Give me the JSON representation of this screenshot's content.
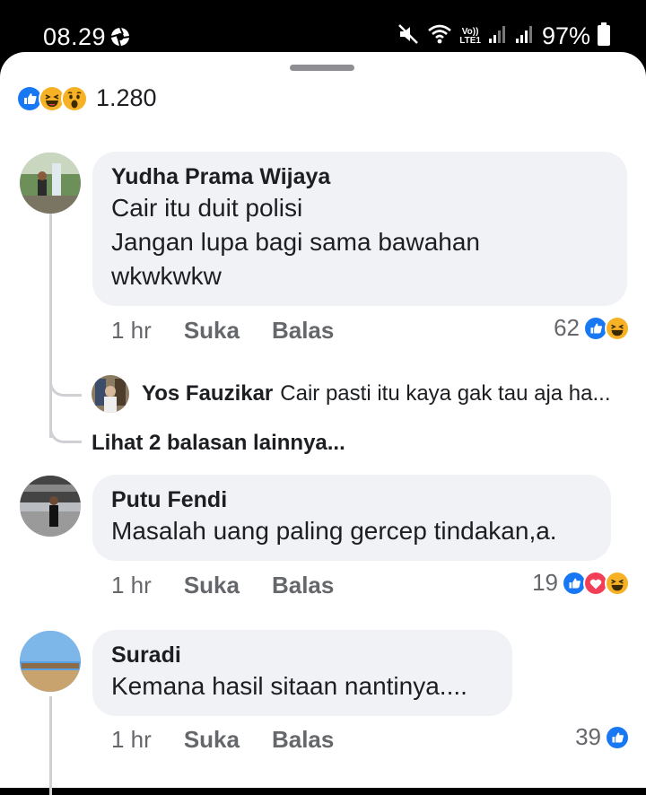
{
  "status_bar": {
    "time": "08.29",
    "volte_label": "Vo))",
    "lte_label": "LTE1",
    "battery": "97%",
    "icons": [
      "aperture-icon",
      "mute-icon",
      "wifi-icon",
      "signal-icon",
      "battery-icon"
    ]
  },
  "summary": {
    "reactions": [
      "like",
      "haha",
      "wow"
    ],
    "count": "1.280"
  },
  "comments": [
    {
      "author": "Yudha Prama Wijaya",
      "lines": [
        "Cair itu duit polisi",
        "Jangan lupa bagi sama bawahan",
        "wkwkwkw"
      ],
      "time": "1 hr",
      "like_label": "Suka",
      "reply_label": "Balas",
      "reaction_count": "62",
      "reactions": [
        "like",
        "haha"
      ],
      "reply": {
        "author": "Yos Fauzikar",
        "text": "Cair pasti itu kaya gak tau aja ha..."
      },
      "more_replies": "Lihat 2 balasan lainnya..."
    },
    {
      "author": "Putu Fendi",
      "lines": [
        "Masalah uang paling gercep tindakan,a."
      ],
      "time": "1 hr",
      "like_label": "Suka",
      "reply_label": "Balas",
      "reaction_count": "19",
      "reactions": [
        "like",
        "love",
        "haha"
      ]
    },
    {
      "author": "Suradi",
      "lines": [
        "Kemana hasil sitaan nantinya...."
      ],
      "time": "1 hr",
      "like_label": "Suka",
      "reply_label": "Balas",
      "reaction_count": "39",
      "reactions": [
        "like"
      ]
    }
  ],
  "colors": {
    "like": "#1877f2",
    "love": "#f33e58",
    "haha": "#f7b125",
    "bubble": "#f0f2f5",
    "meta_text": "#65676b"
  }
}
